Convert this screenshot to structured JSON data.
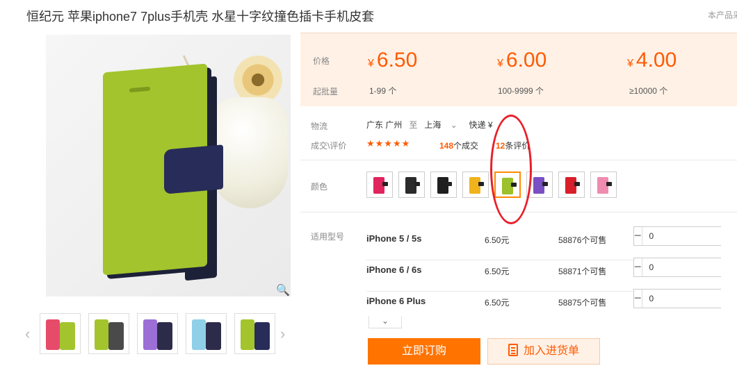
{
  "title": "恒纪元 苹果iphone7 7plus手机壳 水星十字纹撞色插卡手机皮套",
  "corner_note": "本产品采",
  "price_block": {
    "price_label": "价格",
    "moq_label": "起批量",
    "tiers": [
      {
        "currency": "¥",
        "price": "6.50",
        "qty": "1-99 个"
      },
      {
        "currency": "¥",
        "price": "6.00",
        "qty": "100-9999 个"
      },
      {
        "currency": "¥",
        "price": "4.00",
        "qty": "≥10000 个"
      }
    ]
  },
  "logistics": {
    "label": "物流",
    "from": "广东 广州",
    "to_word": "至",
    "to": "上海",
    "dropdown_glyph": "⌄",
    "method": "快递",
    "fee": "¥"
  },
  "deals": {
    "label": "成交\\评价",
    "stars": "★★★★★",
    "rating": 4.5,
    "deal_count": "148",
    "deal_suffix": "个成交",
    "review_count": "12",
    "review_suffix": "条评价"
  },
  "colors": {
    "label": "颜色",
    "swatches": [
      {
        "body": "#e0245e"
      },
      {
        "body": "#2b2b2b"
      },
      {
        "body": "#1f1f1f"
      },
      {
        "body": "#f0b21d"
      },
      {
        "body": "#9cc12a",
        "selected": true
      },
      {
        "body": "#7a4fc4"
      },
      {
        "body": "#d91f2a"
      },
      {
        "body": "#f08bb0"
      }
    ]
  },
  "models": {
    "label": "适用型号",
    "rows": [
      {
        "name": "iPhone 5 / 5s",
        "price": "6.50元",
        "stock": "58876个可售",
        "qty": "0"
      },
      {
        "name": "iPhone 6 / 6s",
        "price": "6.50元",
        "stock": "58871个可售",
        "qty": "0"
      },
      {
        "name": "iPhone 6 Plus",
        "price": "6.50元",
        "stock": "58875个可售",
        "qty": "0"
      }
    ],
    "expand_glyph": "⌄"
  },
  "actions": {
    "buy_now": "立即订购",
    "add_to_list": "加入进货单"
  },
  "gallery": {
    "prev_glyph": "‹",
    "next_glyph": "›",
    "zoom_glyph": "🔍",
    "thumbnails": [
      {
        "c1": "#e64c6a",
        "c2": "#a3c42c"
      },
      {
        "c1": "#a3c42c",
        "c2": "#4a4a4a"
      },
      {
        "c1": "#9c6fd6",
        "c2": "#2c2c4a"
      },
      {
        "c1": "#8fcfe8",
        "c2": "#2c2c4a"
      },
      {
        "c1": "#a3c42c",
        "c2": "#272c59"
      }
    ]
  },
  "colors_theme": {
    "accent": "#ff5a00",
    "buy_button": "#ff7300",
    "price_bg": "#fff1e6",
    "annotation": "#e8202a"
  }
}
